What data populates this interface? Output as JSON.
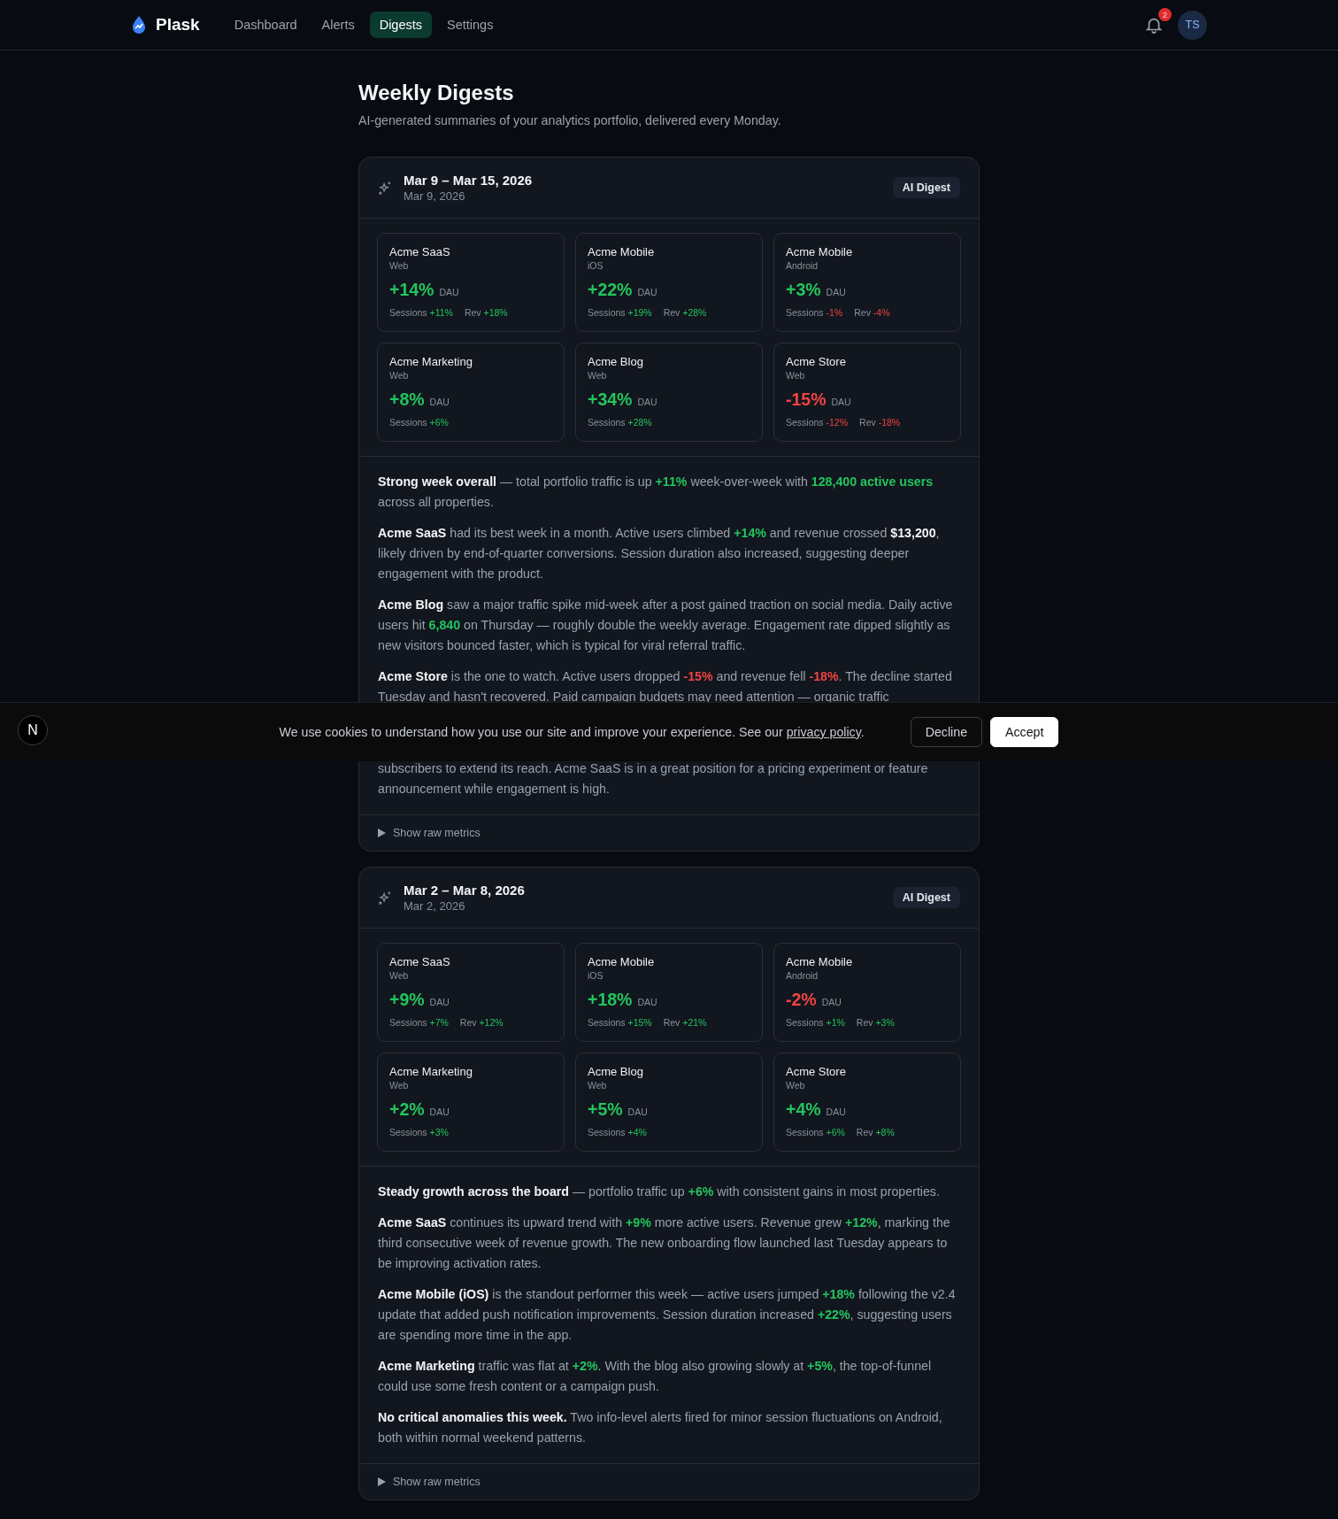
{
  "header": {
    "brand": "Plask",
    "nav": [
      {
        "label": "Dashboard",
        "selected": false
      },
      {
        "label": "Alerts",
        "selected": false
      },
      {
        "label": "Digests",
        "selected": true
      },
      {
        "label": "Settings",
        "selected": false
      }
    ],
    "notifications": "2",
    "avatar": "TS"
  },
  "page": {
    "title": "Weekly Digests",
    "subtitle": "AI-generated summaries of your analytics portfolio, delivered every Monday."
  },
  "digests": [
    {
      "title": "Mar 9 – Mar 15, 2026",
      "date": "Mar 9, 2026",
      "badge": "AI Digest",
      "tiles": [
        {
          "name": "Acme SaaS",
          "platform": "Web",
          "change": "+14%",
          "negative": false,
          "metric": "DAU",
          "stats": [
            {
              "label": "Sessions",
              "value": "+11%",
              "negative": false
            },
            {
              "label": "Rev",
              "value": "+18%",
              "negative": false
            }
          ]
        },
        {
          "name": "Acme Mobile",
          "platform": "iOS",
          "change": "+22%",
          "negative": false,
          "metric": "DAU",
          "stats": [
            {
              "label": "Sessions",
              "value": "+19%",
              "negative": false
            },
            {
              "label": "Rev",
              "value": "+28%",
              "negative": false
            }
          ]
        },
        {
          "name": "Acme Mobile",
          "platform": "Android",
          "change": "+3%",
          "negative": false,
          "metric": "DAU",
          "stats": [
            {
              "label": "Sessions",
              "value": "-1%",
              "negative": true
            },
            {
              "label": "Rev",
              "value": "-4%",
              "negative": true
            }
          ]
        },
        {
          "name": "Acme Marketing",
          "platform": "Web",
          "change": "+8%",
          "negative": false,
          "metric": "DAU",
          "stats": [
            {
              "label": "Sessions",
              "value": "+6%",
              "negative": false
            }
          ]
        },
        {
          "name": "Acme Blog",
          "platform": "Web",
          "change": "+34%",
          "negative": false,
          "metric": "DAU",
          "stats": [
            {
              "label": "Sessions",
              "value": "+28%",
              "negative": false
            }
          ]
        },
        {
          "name": "Acme Store",
          "platform": "Web",
          "change": "-15%",
          "negative": true,
          "metric": "DAU",
          "stats": [
            {
              "label": "Sessions",
              "value": "-12%",
              "negative": true
            },
            {
              "label": "Rev",
              "value": "-18%",
              "negative": true
            }
          ]
        }
      ],
      "paragraphs": [
        {
          "clipped_start": false,
          "clipped_end": false,
          "segments": [
            {
              "text": "Strong week overall",
              "strong": true
            },
            {
              "text": " — total portfolio traffic is up "
            },
            {
              "text": "+11%",
              "color": "#22c55e"
            },
            {
              "text": " week-over-week with "
            },
            {
              "text": "128,400 active users",
              "color": "#22c55e"
            },
            {
              "text": " across all properties."
            }
          ]
        },
        {
          "clipped_start": false,
          "clipped_end": false,
          "segments": [
            {
              "text": "Acme SaaS",
              "strong": true
            },
            {
              "text": " had its best week in a month. Active users climbed "
            },
            {
              "text": "+14%",
              "color": "#22c55e"
            },
            {
              "text": " and revenue crossed "
            },
            {
              "text": "$13,200",
              "strong": true
            },
            {
              "text": ", likely driven by end-of-quarter conversions. Session duration also increased, suggesting deeper engagement with the product."
            }
          ]
        },
        {
          "clipped_start": false,
          "clipped_end": false,
          "segments": [
            {
              "text": "Acme Blog",
              "strong": true
            },
            {
              "text": " saw a major traffic spike mid-week after a post gained traction on social media. Daily active users hit "
            },
            {
              "text": "6,840",
              "color": "#22c55e"
            },
            {
              "text": " on Thursday — roughly double the weekly average. Engagement rate dipped slightly as new visitors bounced faster, which is typical for viral referral traffic."
            }
          ]
        },
        {
          "clipped_start": false,
          "clipped_end": true,
          "segments": [
            {
              "text": "Acme Store",
              "strong": true
            },
            {
              "text": " is the one to watch. Active users dropped "
            },
            {
              "text": "-15%",
              "color": "#ef4444"
            },
            {
              "text": " and revenue fell "
            },
            {
              "text": "-18%",
              "color": "#ef4444"
            },
            {
              "text": ". The decline started Tuesday and hasn't recovered. Paid campaign budgets may need attention — organic traffic"
            }
          ]
        },
        {
          "clipped_start": true,
          "clipped_end": false,
          "segments": [
            {
              "text": "subscribers to extend its reach. Acme SaaS is in a great position for a pricing experiment or feature announcement while engagement is high."
            }
          ]
        }
      ],
      "footer": "Show raw metrics"
    },
    {
      "title": "Mar 2 – Mar 8, 2026",
      "date": "Mar 2, 2026",
      "badge": "AI Digest",
      "tiles": [
        {
          "name": "Acme SaaS",
          "platform": "Web",
          "change": "+9%",
          "negative": false,
          "metric": "DAU",
          "stats": [
            {
              "label": "Sessions",
              "value": "+7%",
              "negative": false
            },
            {
              "label": "Rev",
              "value": "+12%",
              "negative": false
            }
          ]
        },
        {
          "name": "Acme Mobile",
          "platform": "iOS",
          "change": "+18%",
          "negative": false,
          "metric": "DAU",
          "stats": [
            {
              "label": "Sessions",
              "value": "+15%",
              "negative": false
            },
            {
              "label": "Rev",
              "value": "+21%",
              "negative": false
            }
          ]
        },
        {
          "name": "Acme Mobile",
          "platform": "Android",
          "change": "-2%",
          "negative": true,
          "metric": "DAU",
          "stats": [
            {
              "label": "Sessions",
              "value": "+1%",
              "negative": false
            },
            {
              "label": "Rev",
              "value": "+3%",
              "negative": false
            }
          ]
        },
        {
          "name": "Acme Marketing",
          "platform": "Web",
          "change": "+2%",
          "negative": false,
          "metric": "DAU",
          "stats": [
            {
              "label": "Sessions",
              "value": "+3%",
              "negative": false
            }
          ]
        },
        {
          "name": "Acme Blog",
          "platform": "Web",
          "change": "+5%",
          "negative": false,
          "metric": "DAU",
          "stats": [
            {
              "label": "Sessions",
              "value": "+4%",
              "negative": false
            }
          ]
        },
        {
          "name": "Acme Store",
          "platform": "Web",
          "change": "+4%",
          "negative": false,
          "metric": "DAU",
          "stats": [
            {
              "label": "Sessions",
              "value": "+6%",
              "negative": false
            },
            {
              "label": "Rev",
              "value": "+8%",
              "negative": false
            }
          ]
        }
      ],
      "paragraphs": [
        {
          "clipped_start": false,
          "clipped_end": false,
          "segments": [
            {
              "text": "Steady growth across the board",
              "strong": true
            },
            {
              "text": " — portfolio traffic up "
            },
            {
              "text": "+6%",
              "color": "#22c55e"
            },
            {
              "text": " with consistent gains in most properties."
            }
          ]
        },
        {
          "clipped_start": false,
          "clipped_end": false,
          "segments": [
            {
              "text": "Acme SaaS",
              "strong": true
            },
            {
              "text": " continues its upward trend with "
            },
            {
              "text": "+9%",
              "color": "#22c55e"
            },
            {
              "text": " more active users. Revenue grew "
            },
            {
              "text": "+12%",
              "color": "#22c55e"
            },
            {
              "text": ", marking the third consecutive week of revenue growth. The new onboarding flow launched last Tuesday appears to be improving activation rates."
            }
          ]
        },
        {
          "clipped_start": false,
          "clipped_end": false,
          "segments": [
            {
              "text": "Acme Mobile (iOS)",
              "strong": true
            },
            {
              "text": " is the standout performer this week — active users jumped "
            },
            {
              "text": "+18%",
              "color": "#22c55e"
            },
            {
              "text": " following the v2.4 update that added push notification improvements. Session duration increased "
            },
            {
              "text": "+22%",
              "color": "#22c55e"
            },
            {
              "text": ", suggesting users are spending more time in the app."
            }
          ]
        },
        {
          "clipped_start": false,
          "clipped_end": false,
          "segments": [
            {
              "text": "Acme Marketing",
              "strong": true
            },
            {
              "text": " traffic was flat at "
            },
            {
              "text": "+2%",
              "color": "#22c55e"
            },
            {
              "text": ". With the blog also growing slowly at "
            },
            {
              "text": "+5%",
              "color": "#22c55e"
            },
            {
              "text": ", the top-of-funnel could use some fresh content or a campaign push."
            }
          ]
        },
        {
          "clipped_start": false,
          "clipped_end": false,
          "segments": [
            {
              "text": "No critical anomalies this week.",
              "strong": true
            },
            {
              "text": " Two info-level alerts fired for minor session fluctuations on Android, both within normal weekend patterns."
            }
          ]
        }
      ],
      "footer": "Show raw metrics"
    }
  ],
  "cookie_banner": {
    "dev_badge": "N",
    "text_before": "We use cookies to understand how you use our site and improve your experience. See our ",
    "link": "privacy policy",
    "text_after": ".",
    "buttons": [
      {
        "label": "Decline",
        "primary": false
      },
      {
        "label": "Accept",
        "primary": true
      }
    ]
  }
}
